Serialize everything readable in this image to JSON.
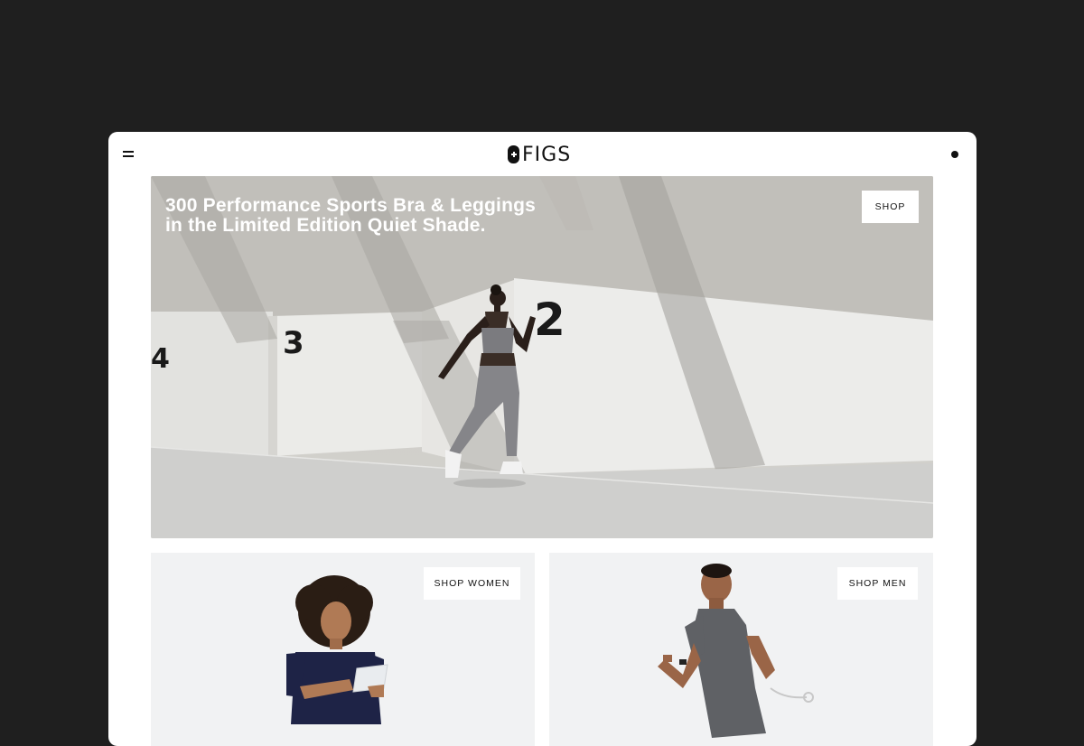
{
  "brand": {
    "name": "FIGS"
  },
  "header": {
    "menu_icon": "hamburger-menu-icon",
    "account_icon": "account-dot-icon"
  },
  "hero": {
    "title": "300 Performance Sports Bra & Leggings in the Limited Edition Quiet Shade.",
    "shop_label": "SHOP",
    "wall_numbers": [
      "4",
      "3",
      "2"
    ]
  },
  "cards": {
    "women": {
      "label": "SHOP WOMEN"
    },
    "men": {
      "label": "SHOP MEN"
    }
  },
  "colors": {
    "background": "#1f1f1f",
    "frame": "#ffffff",
    "text": "#111111",
    "card": "#f1f2f3"
  }
}
